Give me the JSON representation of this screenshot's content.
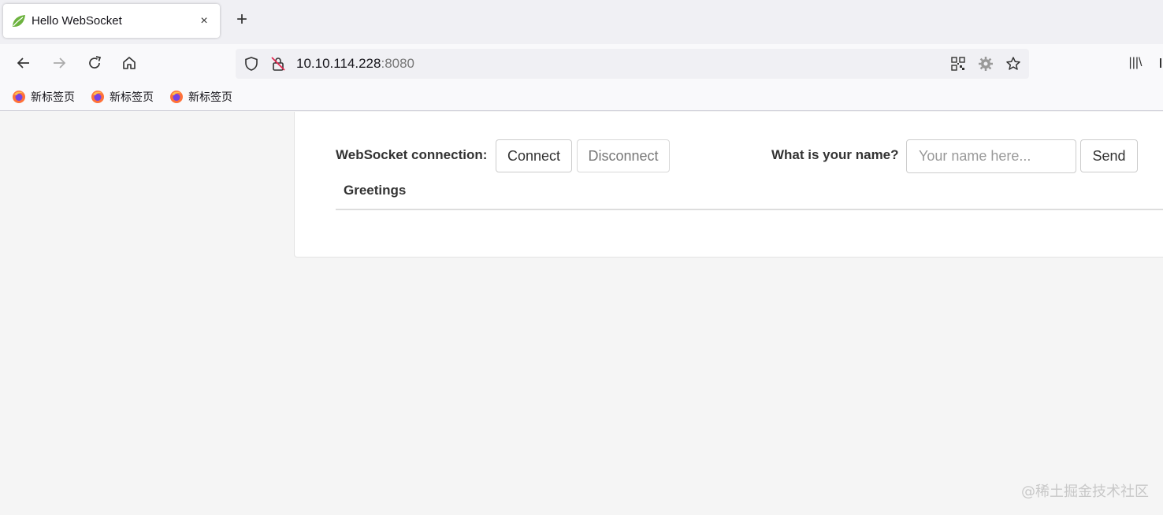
{
  "browser": {
    "tab": {
      "title": "Hello WebSocket",
      "close_label": "×"
    },
    "new_tab_label": "+",
    "url": {
      "host": "10.10.114.228",
      "port": ":8080"
    },
    "bookmarks": [
      {
        "label": "新标签页"
      },
      {
        "label": "新标签页"
      },
      {
        "label": "新标签页"
      }
    ],
    "library_label": "|||\\"
  },
  "page": {
    "connection_label": "WebSocket connection:",
    "connect_button": "Connect",
    "disconnect_button": "Disconnect",
    "name_label": "What is your name?",
    "name_input": {
      "value": "",
      "placeholder": "Your name here..."
    },
    "send_button": "Send",
    "greetings_header": "Greetings"
  },
  "watermark": "@稀土掘金技术社区",
  "colors": {
    "accent_leaf": "#6db33f",
    "firefox_orange": "#ff7139"
  }
}
